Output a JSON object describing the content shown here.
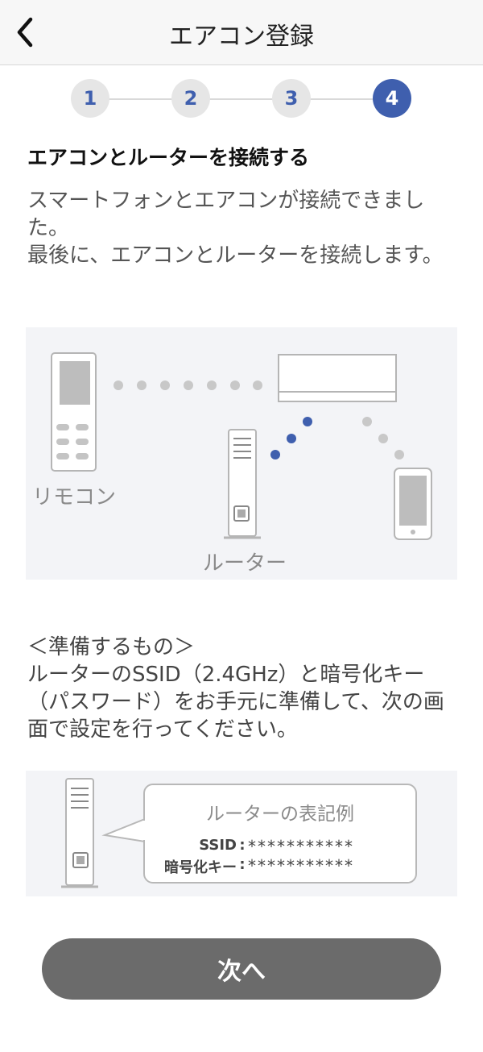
{
  "header": {
    "title": "エアコン登録",
    "back_icon": "chevron-left-icon"
  },
  "steps": {
    "items": [
      "1",
      "2",
      "3",
      "4"
    ],
    "active": "4",
    "active_color": "#3f5fae"
  },
  "heading": "エアコンとルーターを接続する",
  "description": {
    "line1": "スマートフォンとエアコンが接続できました。",
    "line2": "最後に、エアコンとルーターを接続します。"
  },
  "diagram1": {
    "remote_label": "リモコン",
    "router_label": "ルーター"
  },
  "preparation": {
    "title": "＜準備するもの＞",
    "body": "ルーターのSSID（2.4GHz）と暗号化キー（パスワード）をお手元に準備して、次の画面で設定を行ってください。"
  },
  "diagram2": {
    "bubble_title": "ルーターの表記例",
    "ssid_label": "SSID",
    "ssid_value": "***********",
    "key_label": "暗号化キー",
    "key_value": "***********",
    "separator": ":"
  },
  "next_button": "次へ"
}
